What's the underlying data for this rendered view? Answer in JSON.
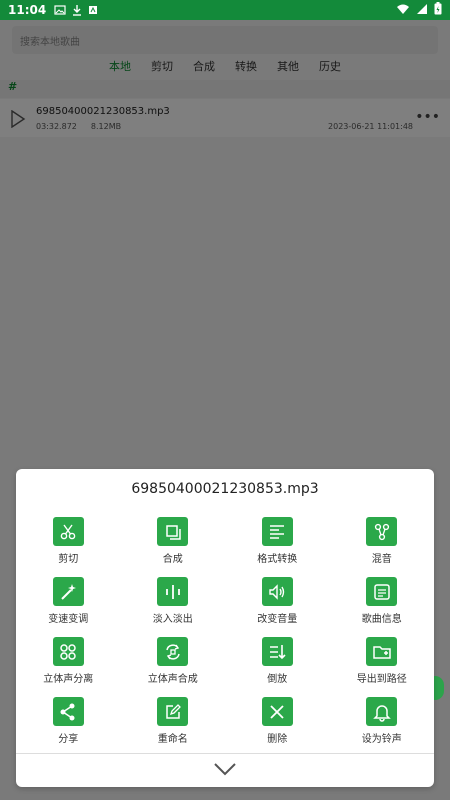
{
  "status_bar": {
    "time": "11:04",
    "left_icons": [
      "image-icon",
      "download-icon",
      "app-icon"
    ],
    "right_icons": [
      "wifi-icon",
      "signal-icon",
      "battery-icon"
    ],
    "background": "#138a3a"
  },
  "background_app": {
    "search": {
      "placeholder": "搜索本地歌曲"
    },
    "tabs": [
      {
        "label": "本地",
        "active": true
      },
      {
        "label": "剪切",
        "active": false
      },
      {
        "label": "合成",
        "active": false
      },
      {
        "label": "转换",
        "active": false
      },
      {
        "label": "其他",
        "active": false
      },
      {
        "label": "历史",
        "active": false
      }
    ],
    "section_label": "#",
    "song": {
      "name": "69850400021230853.mp3",
      "duration": "03:32.872",
      "size": "8.12MB",
      "date": "2023-06-21 11:01:48"
    }
  },
  "sheet": {
    "title": "69850400021230853.mp3",
    "options": [
      {
        "label": "剪切",
        "icon": "scissors-icon"
      },
      {
        "label": "合成",
        "icon": "merge-icon"
      },
      {
        "label": "格式转换",
        "icon": "format-convert-icon"
      },
      {
        "label": "混音",
        "icon": "mix-icon"
      },
      {
        "label": "变速变调",
        "icon": "magic-wand-icon"
      },
      {
        "label": "淡入淡出",
        "icon": "fade-icon"
      },
      {
        "label": "改变音量",
        "icon": "volume-icon"
      },
      {
        "label": "歌曲信息",
        "icon": "info-icon"
      },
      {
        "label": "立体声分离",
        "icon": "stereo-split-icon"
      },
      {
        "label": "立体声合成",
        "icon": "stereo-merge-icon"
      },
      {
        "label": "倒放",
        "icon": "reverse-icon"
      },
      {
        "label": "导出到路径",
        "icon": "export-folder-icon"
      },
      {
        "label": "分享",
        "icon": "share-icon"
      },
      {
        "label": "重命名",
        "icon": "rename-icon"
      },
      {
        "label": "删除",
        "icon": "delete-icon"
      },
      {
        "label": "设为铃声",
        "icon": "ringtone-icon"
      }
    ],
    "collapse_icon": "chevron-down-icon",
    "accent": "#2ba84a"
  }
}
